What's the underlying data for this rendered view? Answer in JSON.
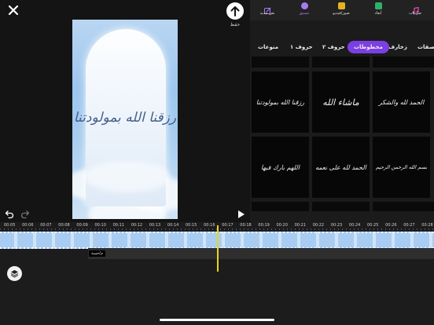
{
  "preview": {
    "export_label": "حفظ",
    "canvas_text": "رزقنا الله بمولودتنا"
  },
  "top_tabs": [
    {
      "label": "صوتيات",
      "icon": "music-note-icon",
      "color": "#e04fb3"
    },
    {
      "label": "أبعاد",
      "icon": "dimensions-icon",
      "color": "#2fae6b"
    },
    {
      "label": "صور/فيديو",
      "icon": "media-icon",
      "color": "#e5b21f"
    },
    {
      "label": "تنسيق",
      "icon": "palette-icon",
      "color": "#a77bf0"
    },
    {
      "label": "نص جديد",
      "icon": "new-text-icon",
      "color": "#a77bf0"
    }
  ],
  "categories": [
    "ملصقات",
    "زخارف",
    "مخطوطات",
    "حروف ٢",
    "حروف ١",
    "منوعات"
  ],
  "active_category": "مخطوطات",
  "tiles": [
    "رزقنا الله بمولودتنا",
    "ماشاء الله",
    "الحمد لله والشكر",
    "اللهم بارك فيها",
    "الحمد لله على نعمه",
    "بسم الله الرحمن الرحيم"
  ],
  "timeline": {
    "ticks": [
      "00:05",
      "00:06",
      "00:07",
      "00:08",
      "00:09",
      "00:10",
      "00:11",
      "00:12",
      "00:13",
      "00:14",
      "00:15",
      "00:16",
      "00:17",
      "00:18",
      "00:19",
      "00:20",
      "00:21",
      "00:22",
      "00:23",
      "00:24",
      "00:25",
      "00:26",
      "00:27",
      "00:28"
    ],
    "text_layer_label": "م/حبيبة"
  }
}
